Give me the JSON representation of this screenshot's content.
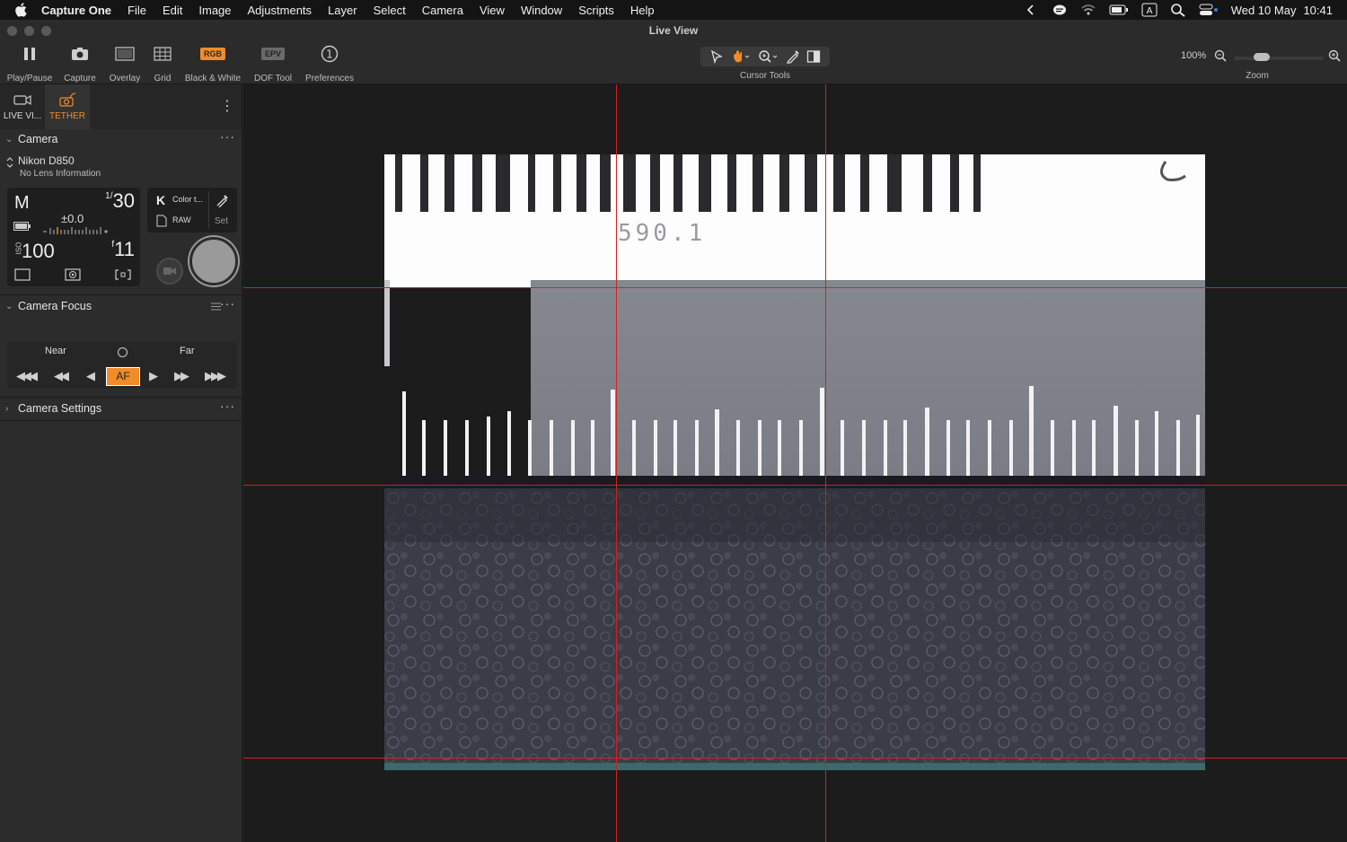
{
  "menubar": {
    "app_name": "Capture One",
    "menus": [
      "File",
      "Edit",
      "Image",
      "Adjustments",
      "Layer",
      "Select",
      "Camera",
      "View",
      "Window",
      "Scripts",
      "Help"
    ],
    "date": "Wed 10 May",
    "time": "10:41"
  },
  "window": {
    "title": "Live View"
  },
  "toolbar": {
    "play_pause": "Play/Pause",
    "capture": "Capture",
    "overlay": "Overlay",
    "grid": "Grid",
    "bw_badge": "RGB",
    "black_white": "Black & White",
    "dof_badge": "EPV",
    "dof_tool": "DOF Tool",
    "preferences": "Preferences",
    "cursor_tools": "Cursor Tools",
    "zoom_percent": "100%",
    "zoom_label": "Zoom",
    "zoom_level": 0.3
  },
  "left_panel": {
    "tabs": [
      {
        "label": "LIVE VI..."
      },
      {
        "label": "TETHER"
      }
    ],
    "camera": {
      "title": "Camera",
      "model": "Nikon D850",
      "lens": "No Lens Information",
      "mode": "M",
      "shutter_num": "1/",
      "shutter_den": "30",
      "ev": "±0.0",
      "iso_label": "ISO",
      "iso": "100",
      "aperture_prefix": "f",
      "aperture": "11",
      "wb_letter": "K",
      "wb_text": "Color t...",
      "format": "RAW",
      "set_label": "Set"
    },
    "focus": {
      "title": "Camera Focus",
      "near": "Near",
      "far": "Far",
      "af": "AF"
    },
    "settings": {
      "title": "Camera Settings"
    }
  },
  "viewer": {
    "ruler_text": "590.1"
  },
  "colors": {
    "accent": "#f08c2a",
    "guide": "#d42020"
  }
}
